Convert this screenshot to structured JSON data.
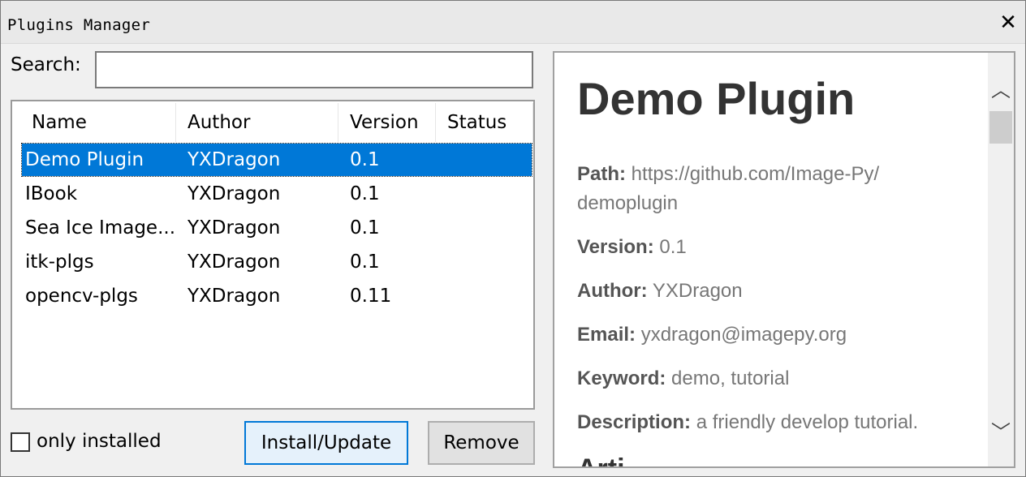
{
  "window": {
    "title": "Plugins Manager",
    "close_glyph": "✕"
  },
  "search": {
    "label": "Search:",
    "value": "",
    "placeholder": ""
  },
  "table": {
    "columns": [
      "Name",
      "Author",
      "Version",
      "Status"
    ],
    "rows": [
      {
        "name": "Demo Plugin",
        "author": "YXDragon",
        "version": "0.1",
        "status": "",
        "selected": true
      },
      {
        "name": "IBook",
        "author": "YXDragon",
        "version": "0.1",
        "status": ""
      },
      {
        "name": "Sea Ice Image...",
        "author": "YXDragon",
        "version": "0.1",
        "status": ""
      },
      {
        "name": "itk-plgs",
        "author": "YXDragon",
        "version": "0.1",
        "status": ""
      },
      {
        "name": "opencv-plgs",
        "author": "YXDragon",
        "version": "0.11",
        "status": ""
      }
    ]
  },
  "filter": {
    "label": "only installed",
    "checked": false
  },
  "buttons": {
    "install": "Install/Update",
    "remove": "Remove"
  },
  "detail": {
    "title": "Demo Plugin",
    "path_label": "Path:",
    "path_value": "https://github.com/Image-Py/demoplugin",
    "version_label": "Version:",
    "version_value": "0.1",
    "author_label": "Author:",
    "author_value": "YXDragon",
    "email_label": "Email:",
    "email_value": "yxdragon@imagepy.org",
    "keyword_label": "Keyword:",
    "keyword_value": "demo, tutorial",
    "description_label": "Description:",
    "description_value": "a friendly develop tutorial.",
    "cutoff_heading": "Arti..."
  },
  "icons": {
    "close": "close-icon",
    "scroll_up": "chevron-up-icon",
    "scroll_down": "chevron-down-icon"
  },
  "colors": {
    "selection": "#0078d7",
    "button_focus_border": "#0078d7",
    "window_bg": "#f0f0f0"
  }
}
